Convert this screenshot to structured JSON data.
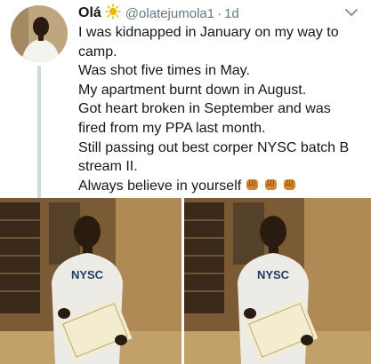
{
  "tweet": {
    "author_name": "Olá",
    "handle": "@olatejumola1",
    "separator": "·",
    "time": "1d",
    "lines": [
      "I was kidnapped in January on my way to camp.",
      "Was shot five times in May.",
      "My apartment burnt down in August.",
      "Got heart broken in September and was fired from my PPA last month.",
      "Still passing out best corper NYSC batch B stream II.",
      "Always believe in yourself"
    ],
    "emoji_count": 3
  },
  "media": {
    "shirt_text": "NYSC",
    "photo_count": 2
  },
  "colors": {
    "text": "#14171a",
    "secondary": "#657786",
    "thread_line": "#cfd9de",
    "emoji_fist": "#d2882c"
  },
  "icons": {
    "verified": "sun-badge-icon",
    "caret": "chevron-down-icon",
    "emoji": "raised-fist-emoji"
  }
}
